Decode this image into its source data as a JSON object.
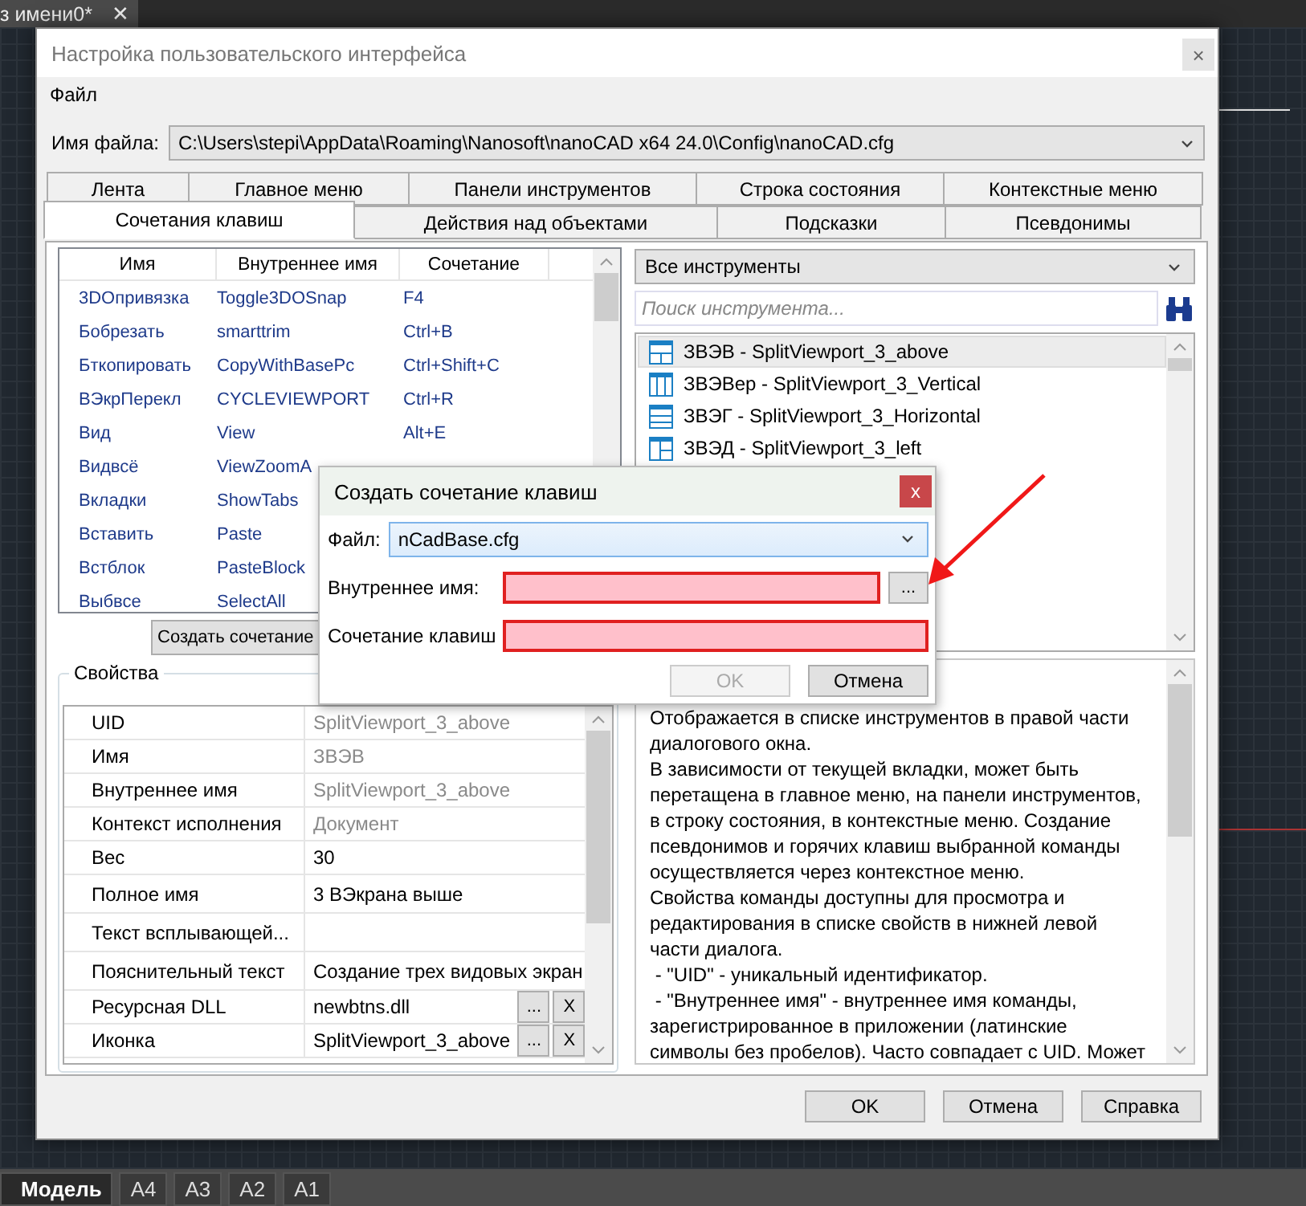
{
  "app_tab": {
    "title": "з имени0*",
    "close": "✕"
  },
  "dialog": {
    "title": "Настройка пользовательского интерфейса",
    "close": "×",
    "menu": [
      "Файл"
    ],
    "file_label": "Имя файла:",
    "file_value": "C:\\Users\\stepi\\AppData\\Roaming\\Nanosoft\\nanoCAD x64 24.0\\Config\\nanoCAD.cfg",
    "tabs_row1": [
      {
        "label": "Лента",
        "selected": false
      },
      {
        "label": "Главное меню",
        "selected": false
      },
      {
        "label": "Панели инструментов",
        "selected": false
      },
      {
        "label": "Строка состояния",
        "selected": false
      },
      {
        "label": "Контекстные меню",
        "selected": false
      }
    ],
    "tabs_row2": [
      {
        "label": "Сочетания клавиш",
        "selected": true
      },
      {
        "label": "Действия над объектами",
        "selected": false
      },
      {
        "label": "Подсказки",
        "selected": false
      },
      {
        "label": "Псевдонимы",
        "selected": false
      }
    ]
  },
  "shortcuts": {
    "columns": [
      "Имя",
      "Внутреннее имя",
      "Сочетание"
    ],
    "rows": [
      [
        "3DОпривязка",
        "Toggle3DOSnap",
        "F4"
      ],
      [
        "Бобрезать",
        "smarttrim",
        "Ctrl+B"
      ],
      [
        "Бткопировать",
        "CopyWithBasePc",
        "Ctrl+Shift+C"
      ],
      [
        "ВЭкрПерекл",
        "CYCLEVIEWPORT",
        "Ctrl+R"
      ],
      [
        "Вид",
        "View",
        "Alt+E"
      ],
      [
        "Видвсё",
        "ViewZoomA"
      ],
      [
        "Вкладки",
        "ShowTabs"
      ],
      [
        "Вставить",
        "Paste"
      ],
      [
        "Встблок",
        "PasteBlock"
      ],
      [
        "Выбвсе",
        "SelectAll"
      ]
    ],
    "create_button": "Создать сочетание"
  },
  "properties": {
    "title": "Свойства",
    "rows": [
      {
        "name": "UID",
        "value": "SplitViewport_3_above",
        "readonly": true
      },
      {
        "name": "Имя",
        "value": "ЗВЭВ",
        "readonly": true
      },
      {
        "name": "Внутреннее имя",
        "value": "SplitViewport_3_above",
        "readonly": true
      },
      {
        "name": "Контекст исполнения",
        "value": "Документ",
        "readonly": true
      },
      {
        "name": "Вес",
        "value": "30",
        "readonly": false
      },
      {
        "name": "Полное имя",
        "value": "3 ВЭкрана выше",
        "readonly": false
      },
      {
        "name": "Текст всплывающей..."
      },
      {
        "name": "Пояснительный текст",
        "value": "Создание трех видовых экран",
        "readonly": false
      },
      {
        "name": "Ресурсная DLL",
        "value": "newbtns.dll",
        "readonly": false,
        "actions": [
          "...",
          "X"
        ]
      },
      {
        "name": "Иконка",
        "value": "SplitViewport_3_above",
        "readonly": false,
        "actions": [
          "...",
          "X"
        ]
      }
    ]
  },
  "tools": {
    "category": "Все инструменты",
    "search": {
      "placeholder": "Поиск инструмента..."
    },
    "items": [
      {
        "label": "ЗВЭВ - SplitViewport_3_above",
        "kind": "above",
        "selected": true
      },
      {
        "label": "ЗВЭВер - SplitViewport_3_Vertical",
        "kind": "vertical",
        "selected": false
      },
      {
        "label": "ЗВЭГ - SplitViewport_3_Horizontal",
        "kind": "horizontal",
        "selected": false
      },
      {
        "label": "ЗВЭД - SplitViewport_3_left",
        "kind": "left",
        "selected": false
      }
    ],
    "description": [
      "Отображается в списке инструментов в правой части диалогового окна.",
      "В зависимости от текущей вкладки, может быть перетащена в главное меню, на панели инструментов, в строку состояния, в контекстные меню. Создание псевдонимов и горячих клавиш выбранной команды осуществляется через контекстное меню.",
      "Свойства команды доступны для просмотра и редактирования в списке свойств в нижней левой части диалога.",
      " - \"UID\" - уникальный идентификатор.",
      " - \"Внутреннее имя\" - внутреннее имя команды, зарегистрированное в приложении (латинские символы без пробелов). Часто совпадает с UID. Может"
    ]
  },
  "footer_buttons": [
    "OK",
    "Отмена",
    "Справка"
  ],
  "modal": {
    "title": "Создать сочетание клавиш",
    "close": "x",
    "file_label": "Файл:",
    "file_value": "nCadBase.cfg",
    "internal_label": "Внутреннее имя:",
    "internal_invalid": true,
    "browse": "...",
    "shortcut_label": "Сочетание клавиш",
    "shortcut_invalid": true,
    "ok": {
      "label": "OK",
      "disabled": true
    },
    "cancel": "Отмена"
  },
  "layout_tabs": [
    {
      "label": "Модель",
      "selected": true
    },
    {
      "label": "A4",
      "selected": false
    },
    {
      "label": "A3",
      "selected": false
    },
    {
      "label": "A2",
      "selected": false
    },
    {
      "label": "A1",
      "selected": false
    }
  ]
}
